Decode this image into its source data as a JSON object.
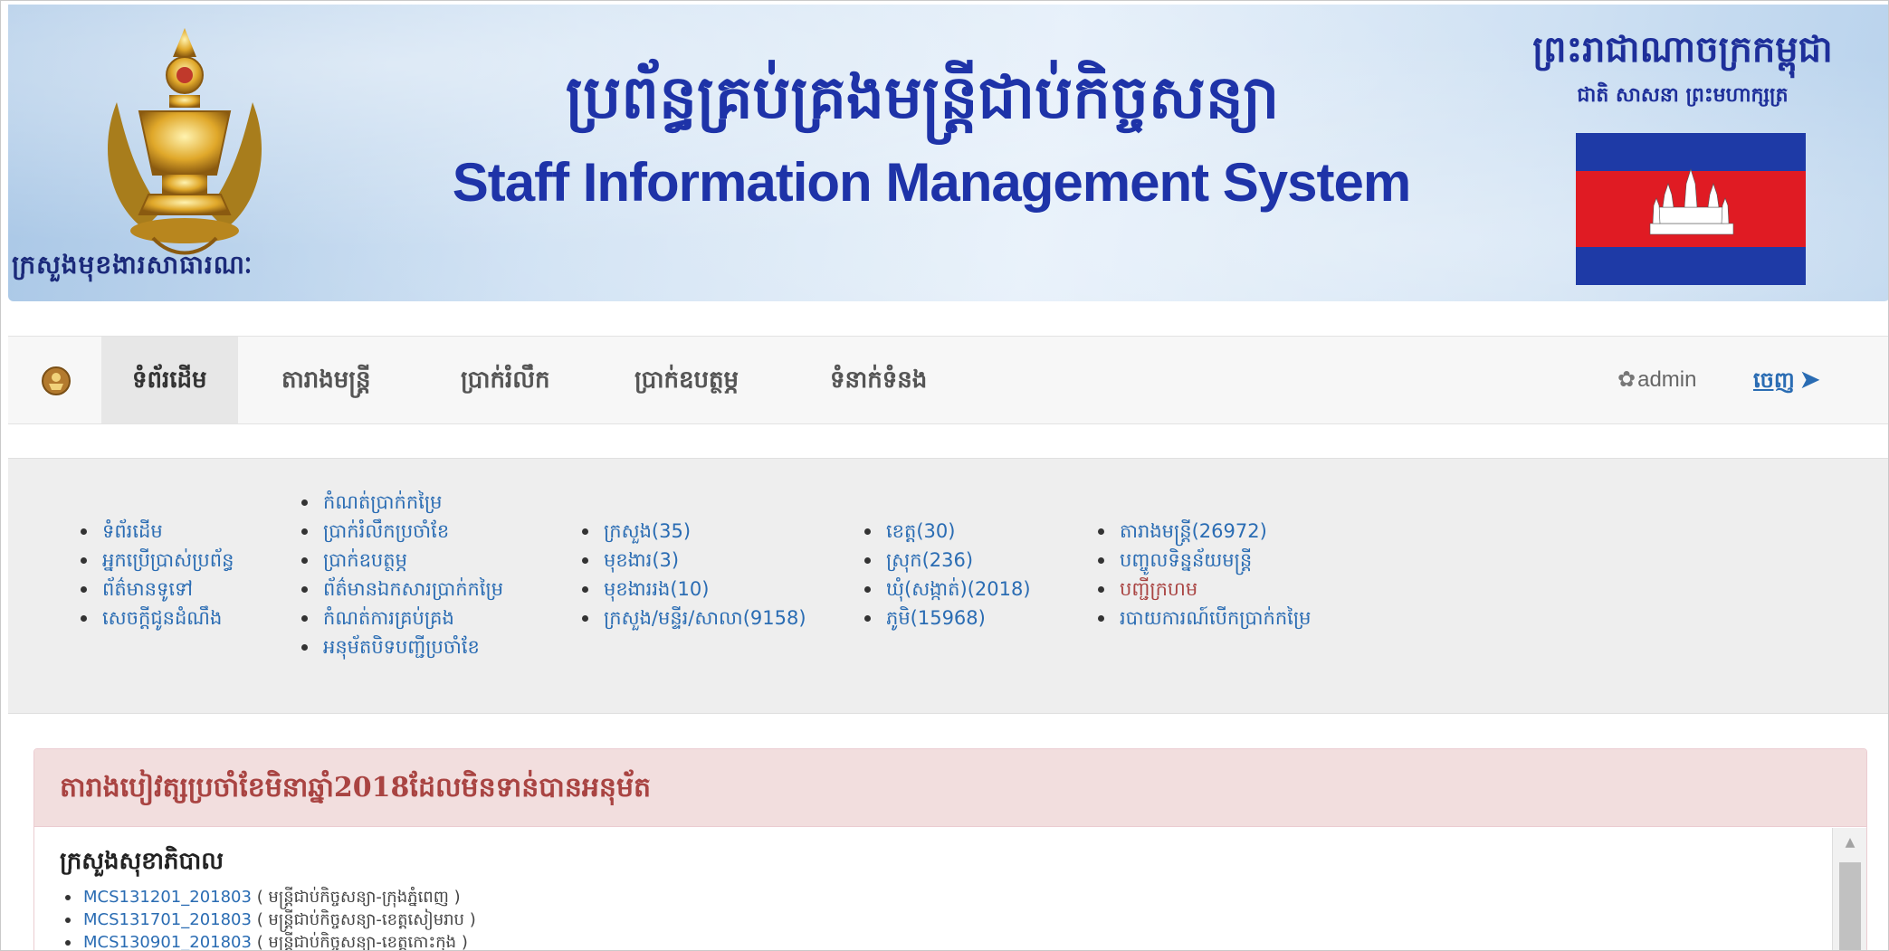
{
  "banner": {
    "title_km": "ប្រព័ន្ធគ្រប់គ្រងមន្ត្រីជាប់កិច្ចសន្យា",
    "title_en": "Staff Information Management System",
    "ministry": "ក្រសួងមុខងារសាធារណៈ",
    "kingdom": "ព្រះរាជាណាចក្រកម្ពុជា",
    "motto": "ជាតិ សាសនា ព្រះមហាក្សត្រ",
    "flag_colors": {
      "blue": "#1e3aa6",
      "red": "#e01b23",
      "white": "#ffffff"
    }
  },
  "navbar": {
    "items": [
      {
        "label": "ទំព័រដើម",
        "active": true
      },
      {
        "label": "តារាងមន្ត្រី",
        "active": false
      },
      {
        "label": "ប្រាក់រំលឹក",
        "active": false
      },
      {
        "label": "ប្រាក់ឧបត្ថម្ភ",
        "active": false
      },
      {
        "label": "ទំនាក់ទំនង",
        "active": false
      }
    ],
    "user": "admin",
    "logout": "ចេញ"
  },
  "quick_links": {
    "col1": [
      "ទំព័រដើម",
      "អ្នកប្រើប្រាស់ប្រព័ន្ធ",
      "ព័ត៌មានទូទៅ",
      "សេចក្តីជូនដំណឹង"
    ],
    "col2": [
      "កំណត់ប្រាក់កម្រៃ",
      "ប្រាក់រំលឹកប្រចាំខែ",
      "ប្រាក់ឧបត្ថម្ភ",
      "ព័ត៌មានឯកសារប្រាក់កម្រៃ",
      "កំណត់ការគ្រប់គ្រង",
      "អនុម័តបិទបញ្ជីប្រចាំខែ"
    ],
    "col3": [
      "ក្រសួង(35)",
      "មុខងារ(3)",
      "មុខងាររង(10)",
      "ក្រសួង/មន្ទីរ/សាលា(9158)"
    ],
    "col4": [
      "ខេត្ត(30)",
      "ស្រុក(236)",
      "ឃុំ(សង្កាត់)(2018)",
      "ភូមិ(15968)"
    ],
    "col5": [
      "តារាងមន្ត្រី(26972)",
      "បញ្ចូលទិន្នន័យមន្ត្រី",
      "បញ្ជីក្រហម",
      "របាយការណ៍បើកប្រាក់កម្រៃ"
    ]
  },
  "alert": {
    "heading": "តារាងបៀវត្សប្រចាំខែមិនាឆ្នាំ2018ដែលមិនទាន់បានអនុម័ត",
    "ministry": "ក្រសួងសុខាភិបាល",
    "documents": [
      {
        "code": "MCS131201_201803",
        "desc": "( មន្ត្រីជាប់កិច្ចសន្យា-ក្រុងភ្នំពេញ )"
      },
      {
        "code": "MCS131701_201803",
        "desc": "( មន្ត្រីជាប់កិច្ចសន្យា-ខេត្តសៀមរាប )"
      },
      {
        "code": "MCS130901_201803",
        "desc": "( មន្ត្រីជាប់កិច្ចសន្យា-ខេត្តកោះកុង )"
      }
    ]
  }
}
